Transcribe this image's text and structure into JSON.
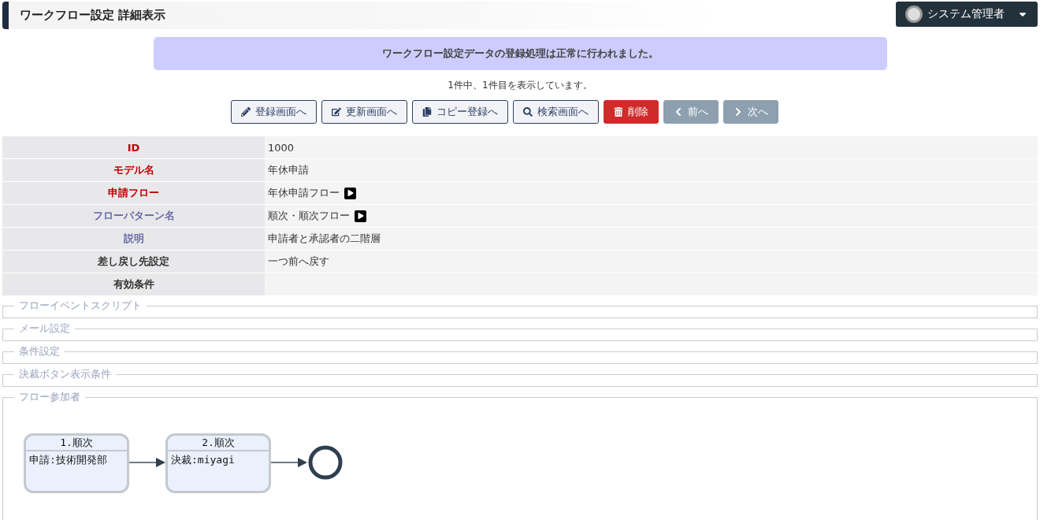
{
  "header": {
    "title": "ワークフロー設定 詳細表示",
    "user": "システム管理者"
  },
  "message": "ワークフロー設定データの登録処理は正常に行われました。",
  "record_count": "1件中、1件目を表示しています。",
  "buttons": [
    {
      "label": "登録画面へ",
      "kind": "outline",
      "disabled": false
    },
    {
      "label": "更新画面へ",
      "kind": "outline",
      "disabled": false
    },
    {
      "label": "コピー登録へ",
      "kind": "outline",
      "disabled": false
    },
    {
      "label": "検索画面へ",
      "kind": "outline",
      "disabled": false
    },
    {
      "label": "削除",
      "kind": "danger",
      "disabled": false
    },
    {
      "label": "前へ",
      "kind": "outline",
      "disabled": true
    },
    {
      "label": "次へ",
      "kind": "outline",
      "disabled": true
    }
  ],
  "details": [
    {
      "label": "ID",
      "kind": "required",
      "value": "1000",
      "link": false
    },
    {
      "label": "モデル名",
      "kind": "required",
      "value": "年休申請",
      "link": false
    },
    {
      "label": "申請フロー",
      "kind": "required",
      "value": "年休申請フロー",
      "link": true
    },
    {
      "label": "フローパターン名",
      "kind": "reference",
      "value": "順次・順次フロー",
      "link": true
    },
    {
      "label": "説明",
      "kind": "reference",
      "value": "申請者と承認者の二階層",
      "link": false
    },
    {
      "label": "差し戻し先設定",
      "kind": "normal",
      "value": "一つ前へ戻す",
      "link": false
    },
    {
      "label": "有効条件",
      "kind": "normal",
      "link": false
    }
  ],
  "sections": [
    {
      "legend": "フローイベントスクリプト"
    },
    {
      "legend": "メール設定"
    },
    {
      "legend": "条件設定"
    },
    {
      "legend": "決裁ボタン表示条件"
    },
    {
      "legend": "フロー参加者",
      "nodes": [
        {
          "title": "1.順次",
          "body": "申請:技術開発部"
        },
        {
          "title": "2.順次",
          "body": "決裁:miyagi"
        }
      ]
    }
  ]
}
